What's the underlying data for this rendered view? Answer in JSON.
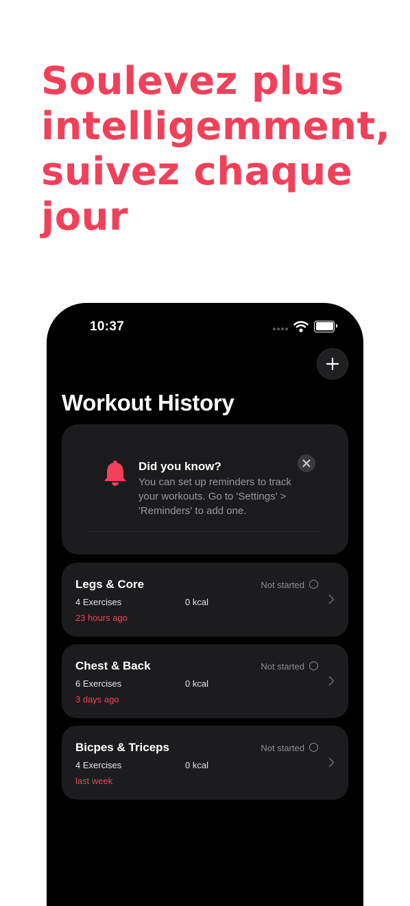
{
  "headline": "Soulevez plus intelligemment, suivez chaque jour",
  "status_bar": {
    "time": "10:37"
  },
  "page_title": "Workout History",
  "tip": {
    "title": "Did you know?",
    "body": "You can set up reminders to track your workouts. Go to 'Settings' > 'Reminders' to add one."
  },
  "workouts": [
    {
      "name": "Legs & Core",
      "exercises": "4 Exercises",
      "kcal": "0 kcal",
      "time": "23 hours ago",
      "status": "Not started"
    },
    {
      "name": "Chest & Back",
      "exercises": "6 Exercises",
      "kcal": "0 kcal",
      "time": "3 days ago",
      "status": "Not started"
    },
    {
      "name": "Bicpes & Triceps",
      "exercises": "4 Exercises",
      "kcal": "0 kcal",
      "time": "last week",
      "status": "Not started"
    }
  ],
  "colors": {
    "accent": "#f2405a",
    "background": "#000000",
    "card": "#1c1c1e"
  }
}
